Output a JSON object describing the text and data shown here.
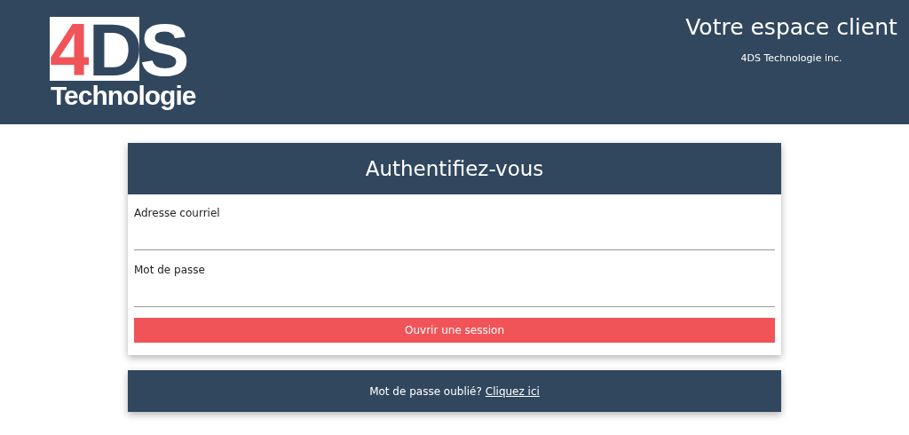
{
  "header": {
    "logo": {
      "mark": "4DS",
      "name": "Technologie"
    },
    "title": "Votre espace client",
    "subtitle": "4DS Technologie inc."
  },
  "login": {
    "title": "Authentifiez-vous",
    "fields": [
      {
        "label": "Adresse courriel"
      },
      {
        "label": "Mot de passe"
      }
    ],
    "submit": "Ouvrir une session"
  },
  "footer": {
    "text": "Mot de passe oublié?",
    "link": "Cliquez ici"
  }
}
